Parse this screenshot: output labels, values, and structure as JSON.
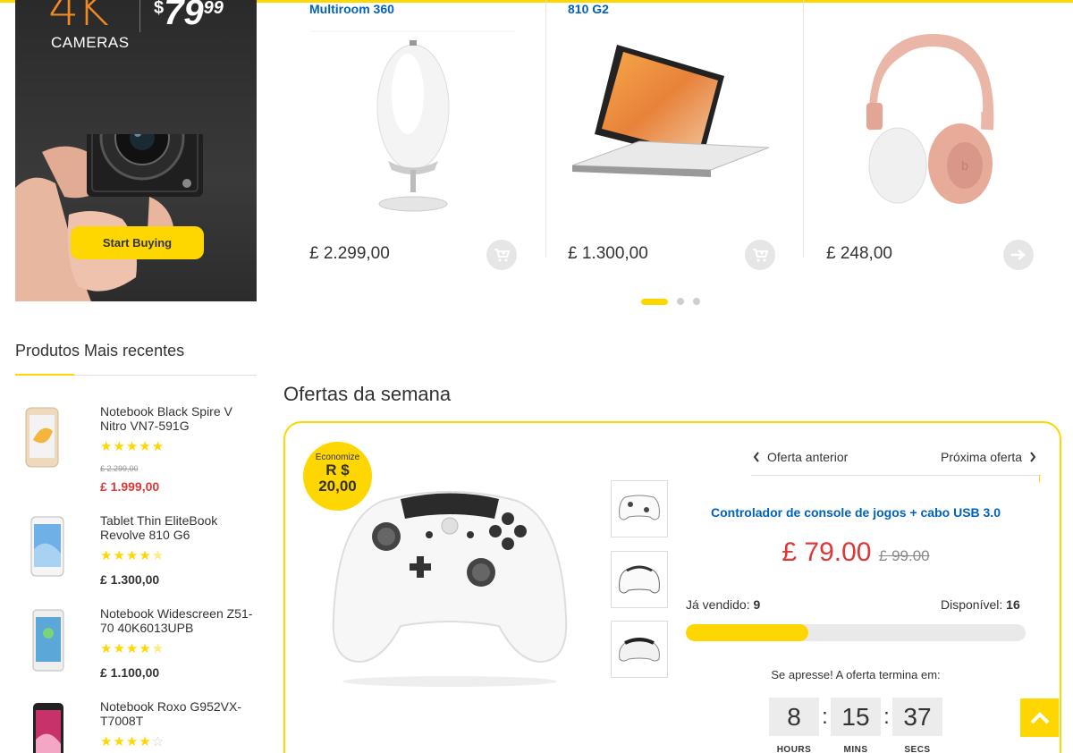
{
  "promo": {
    "headline": "4K",
    "subtitle": "CAMERAS",
    "price_currency": "$",
    "price_int": "79",
    "price_cents": "99",
    "button_label": "Start Buying"
  },
  "carousel": {
    "products": [
      {
        "title": "Multiroom 360",
        "price": "£ 2.299,00",
        "action_icon": "add-to-cart-icon"
      },
      {
        "title": "810 G2",
        "price": "£ 1.300,00",
        "action_icon": "add-to-cart-icon"
      },
      {
        "title": "",
        "price": "£ 248,00",
        "action_icon": "arrow-right-icon"
      }
    ],
    "active_page": 1,
    "page_count": 3
  },
  "recent": {
    "title": "Produtos Mais recentes",
    "items": [
      {
        "name": "Notebook Black Spire V Nitro VN7-591G",
        "rating": 5,
        "old_price": "£ 2.299,00",
        "price": "£ 1.999,00"
      },
      {
        "name": "Tablet Thin EliteBook Revolve 810 G6",
        "rating": 4.5,
        "old_price": "",
        "price": "£ 1.300,00"
      },
      {
        "name": "Notebook Widescreen Z51-70 40K6013UPB",
        "rating": 4.5,
        "old_price": "",
        "price": "£ 1.100,00"
      },
      {
        "name": "Notebook Roxo G952VX-T7008T",
        "rating": 4,
        "old_price": "",
        "price": ""
      }
    ]
  },
  "deals": {
    "title": "Ofertas da semana",
    "badge_line1": "Economize",
    "badge_line2": "R $",
    "badge_line3": "20,00",
    "prev_label": "Oferta anterior",
    "next_label": "Próxima oferta",
    "product_name": "Controlador de console de jogos + cabo USB 3.0",
    "price_now": "£ 79.00",
    "price_was": "£ 99.00",
    "sold_label": "Já vendido:",
    "sold_value": "9",
    "available_label": "Disponível:",
    "available_value": "16",
    "sold_fraction": 0.36,
    "hurry_text": "Se apresse! A oferta termina em:",
    "timer": {
      "hours": "8",
      "minutes": "15",
      "seconds": "37",
      "hours_label": "HOURS",
      "minutes_label": "MINS",
      "seconds_label": "SECS"
    }
  },
  "colors": {
    "accent": "#fed700",
    "link": "#0062bd",
    "sale": "#df3737"
  }
}
